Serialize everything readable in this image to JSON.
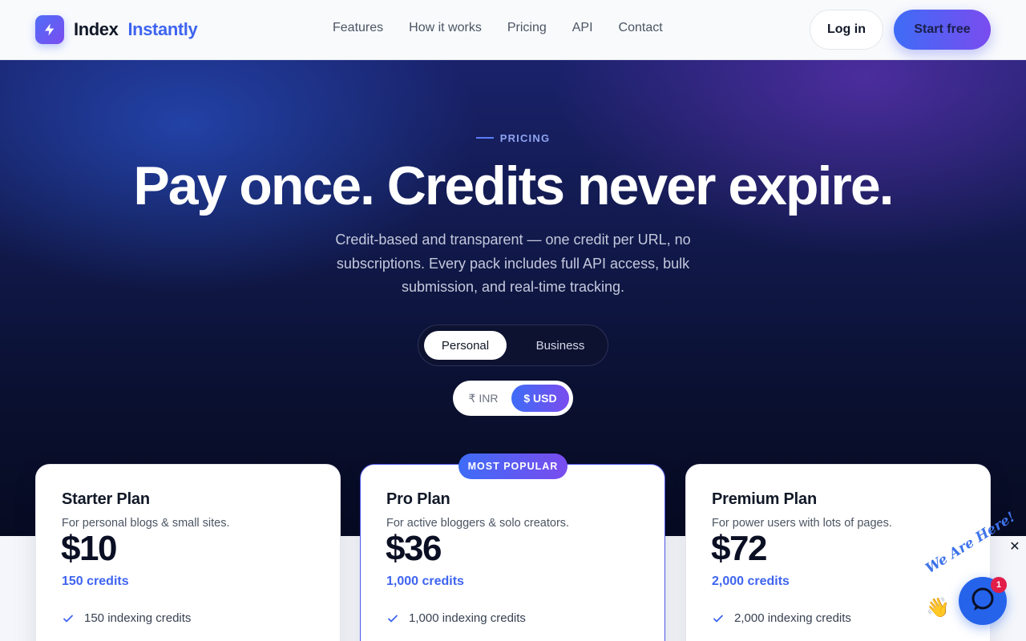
{
  "brand": {
    "name_part1": "Index",
    "name_part2": "Instantly",
    "icon": "lightning-bolt-icon"
  },
  "nav": {
    "links": [
      "Features",
      "How it works",
      "Pricing",
      "API",
      "Contact"
    ],
    "login_label": "Log in",
    "start_label": "Start free"
  },
  "hero": {
    "eyebrow": "PRICING",
    "headline": "Pay once. Credits never expire.",
    "subtext": "Credit-based and transparent — one credit per URL, no subscriptions. Every pack includes full API access, bulk submission, and real-time tracking.",
    "segment": {
      "options": [
        "Personal",
        "Business"
      ],
      "selected": "Personal"
    },
    "currency": {
      "inr": "₹ INR",
      "usd": "$ USD",
      "selected": "$ USD"
    }
  },
  "plans": [
    {
      "name": "Starter Plan",
      "desc": "For personal blogs & small sites.",
      "price": "$10",
      "credits": "150 credits",
      "feature": "150 indexing credits"
    },
    {
      "name": "Pro Plan",
      "desc": "For active bloggers & solo creators.",
      "price": "$36",
      "credits": "1,000 credits",
      "feature": "1,000 indexing credits",
      "badge": "MOST POPULAR"
    },
    {
      "name": "Premium Plan",
      "desc": "For power users with lots of pages.",
      "price": "$72",
      "credits": "2,000 credits",
      "feature": "2,000 indexing credits"
    }
  ],
  "chat": {
    "banner": "We Are Here!",
    "count": "1",
    "close": "✕"
  },
  "colors": {
    "accent": "#3e64f0",
    "accent2": "#7a4cef",
    "hero_dark": "#0a1030"
  }
}
